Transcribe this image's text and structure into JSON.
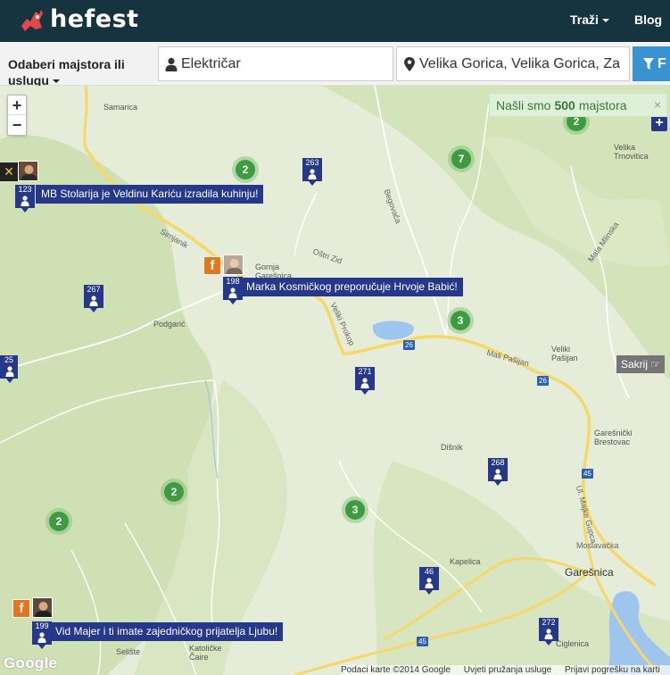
{
  "header": {
    "logo_text": "hefest",
    "nav_search": "Traži",
    "nav_blog": "Blog"
  },
  "search": {
    "choose_label": "Odaberi majstora ili uslugu",
    "service_value": "Električar",
    "location_value": "Velika Gorica, Velika Gorica, Za",
    "filter_label": "F"
  },
  "map": {
    "zoom_in": "+",
    "zoom_out": "−",
    "found": {
      "prefix": "Našli smo",
      "count": "500",
      "suffix": "majstora",
      "close": "×"
    },
    "hide_label": "Sakrij ☞",
    "plus_label": "+",
    "clusters": [
      "2",
      "2",
      "7",
      "3",
      "2",
      "2",
      "3"
    ],
    "pins": [
      "123",
      "263",
      "267",
      "198",
      "25",
      "271",
      "268",
      "46",
      "199",
      "272"
    ],
    "bubbles": [
      "MB Stolarija je Veldinu Kariću izradila kuhinju!",
      "Marka Kosmičkog preporučuje Hrvoje Babić!",
      "Vid Majer i ti imate zajedničkog prijatelja Ljubu!"
    ],
    "fb_letter": "f",
    "places": {
      "samarica": "Samarica",
      "gornja": "Gornja",
      "garesnica_small": "Garešnica",
      "podgaric": "Podgarić",
      "velika_trnovitica": "Velika\nTrnovitica",
      "veliki_pasijan": "Veliki\nPašijan",
      "garesnicki_brestovac": "Garešnički\nBrestovac",
      "disnik": "Dišnik",
      "kapelica": "Kapelica",
      "garesnica": "Garešnica",
      "seliste": "Selište",
      "katolicke_caire": "Katoličke\nČaire",
      "ciglenica": "Ciglenica",
      "moslavacka": "Moslavačka",
      "ostri_zid": "Oštri Zid",
      "begovaca": "Begovača",
      "mala_mlinska": "Mala Mlinska",
      "mali_pasijan": "Mali Pašijan",
      "sirnjanik": "Sirnjanik",
      "veliki_prokop": "Veliki Prokop",
      "ul_majke_gupca": "Ul. Majke Gupca"
    },
    "roads": {
      "r26a": "26",
      "r26b": "26",
      "r45a": "45",
      "r45b": "45"
    },
    "attribution": [
      "Podaci karte ©2014 Google",
      "Uvjeti pružanja usluge",
      "Prijavi pogrešku na karti"
    ],
    "google_logo": "Google"
  }
}
